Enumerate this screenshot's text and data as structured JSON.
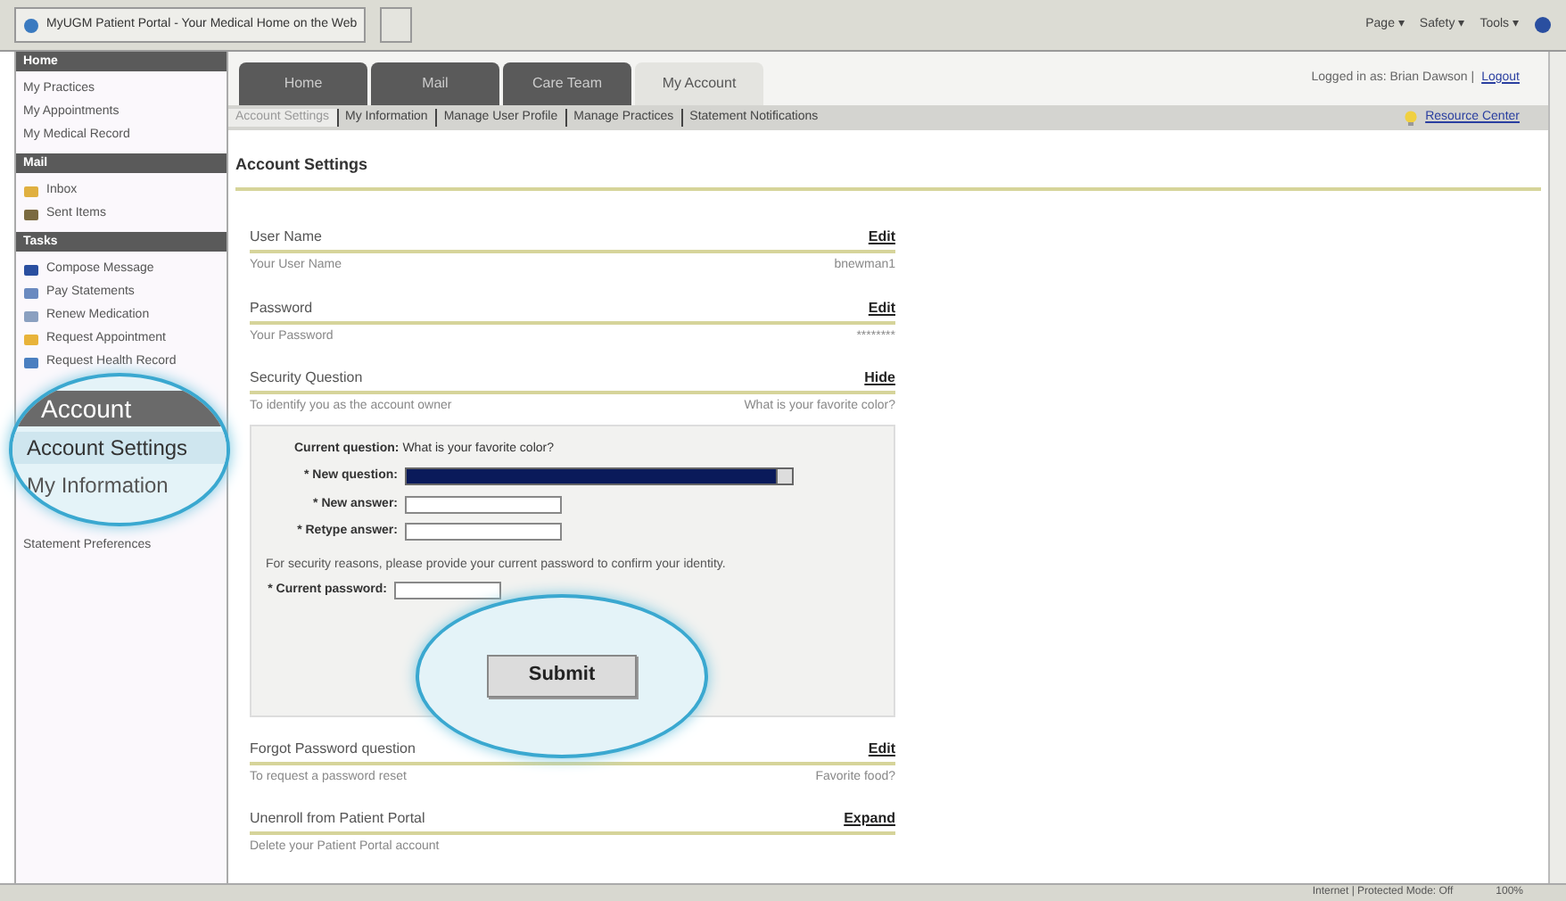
{
  "browser": {
    "tab_title": "MyUGM Patient Portal - Your Medical Home on the Web",
    "toolbar": [
      "Page ▾",
      "Safety ▾",
      "Tools ▾"
    ],
    "status_zone": "Internet | Protected Mode: Off",
    "status_zoom": "100%"
  },
  "sidebar": {
    "sections": [
      {
        "title": "Home",
        "items": [
          "My Practices",
          "My Appointments",
          "My Medical Record"
        ]
      },
      {
        "title": "Mail",
        "items": [
          "Inbox",
          "Sent Items"
        ]
      },
      {
        "title": "Tasks",
        "items": [
          "Compose Message",
          "Pay Statements",
          "Renew Medication",
          "Request Appointment",
          "Request Health Record"
        ]
      }
    ],
    "callout": {
      "title": "Account",
      "items": [
        {
          "label": "Account Settings",
          "selected": true
        },
        {
          "label": "My Information",
          "selected": false
        }
      ]
    },
    "after_callout": "Statement Preferences"
  },
  "tabs": [
    {
      "label": "Home",
      "selected": false
    },
    {
      "label": "Mail",
      "selected": false
    },
    {
      "label": "Care Team",
      "selected": false
    },
    {
      "label": "My Account",
      "selected": true
    }
  ],
  "logged_in": "Logged in as: Brian Dawson |",
  "logout": "Logout",
  "subnav": [
    {
      "label": "Account Settings",
      "selected": true
    },
    {
      "label": "My Information",
      "selected": false
    },
    {
      "label": "Manage User Profile",
      "selected": false
    },
    {
      "label": "Manage Practices",
      "selected": false
    },
    {
      "label": "Statement Notifications",
      "selected": false
    }
  ],
  "resource_link": "Resource Center",
  "heading": "Account Settings",
  "settings": [
    {
      "title": "User Name",
      "action": "Edit",
      "desc": "Your User Name",
      "value": "bnewman1"
    },
    {
      "title": "Password",
      "action": "Edit",
      "desc": "Your Password",
      "value": "********"
    },
    {
      "title": "Security Question",
      "action": "Hide",
      "desc": "To identify you as the account owner",
      "value": "What is your favorite color?",
      "expanded": true
    },
    {
      "title": "Forgot Password question",
      "action": "Edit",
      "desc": "To request a password reset",
      "value": "Favorite food?"
    },
    {
      "title": "Unenroll from Patient Portal",
      "action": "Expand",
      "desc": "Delete your Patient Portal account"
    }
  ],
  "form": {
    "current_label": "Current question:",
    "current_value": "What is your favorite color?",
    "fields": [
      {
        "label": "* New question:",
        "kind": "select"
      },
      {
        "label": "* New answer:",
        "kind": "text"
      },
      {
        "label": "* Retype answer:",
        "kind": "text"
      }
    ],
    "note": "For security reasons, please provide your current password to confirm your identity.",
    "password_label": "* Current password:",
    "submit": "Submit"
  }
}
